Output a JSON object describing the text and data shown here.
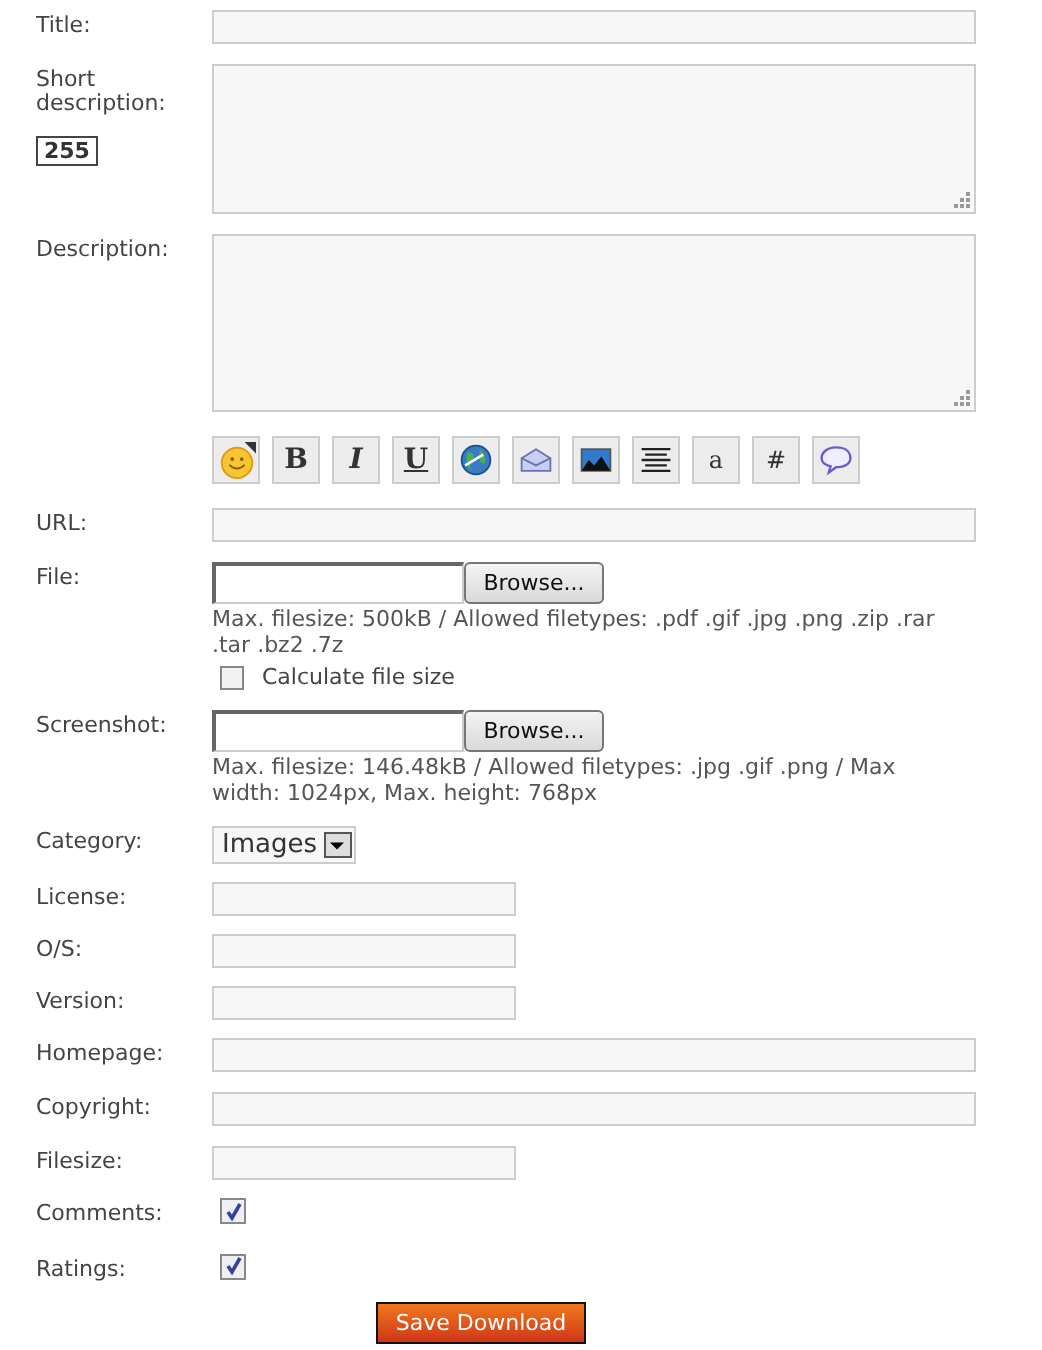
{
  "fields": [
    {
      "kind": "long-text",
      "label": "Title:"
    },
    {
      "kind": "textarea",
      "label": "Short description:",
      "counter": "255"
    },
    {
      "kind": "editor",
      "label": "Description:",
      "toolbar": [
        {
          "kind": "smiley"
        },
        {
          "kind": "bold",
          "glyph": "B"
        },
        {
          "kind": "italic",
          "glyph": "I"
        },
        {
          "kind": "underline",
          "glyph": "U"
        },
        {
          "kind": "globe"
        },
        {
          "kind": "envelope"
        },
        {
          "kind": "image"
        },
        {
          "kind": "align"
        },
        {
          "kind": "plain",
          "glyph": "a"
        },
        {
          "kind": "plain",
          "glyph": "#"
        },
        {
          "kind": "speech"
        }
      ]
    },
    {
      "kind": "long-text",
      "label": "URL:"
    },
    {
      "kind": "file",
      "label": "File:",
      "button": "Browse...",
      "note": "Max. filesize: 500kB / Allowed filetypes: .pdf .gif .jpg .png .zip .rar .tar .bz2 .7z",
      "option": {
        "label": "Calculate file size",
        "checked": false
      }
    },
    {
      "kind": "file",
      "label": "Screenshot:",
      "button": "Browse...",
      "note": "Max. filesize: 146.48kB / Allowed filetypes: .jpg .gif .png / Max width: 1024px, Max. height: 768px"
    },
    {
      "kind": "select",
      "label": "Category:",
      "value": "Images"
    },
    {
      "kind": "short-text",
      "label": "License:"
    },
    {
      "kind": "short-text",
      "label": "O/S:"
    },
    {
      "kind": "short-text",
      "label": "Version:"
    },
    {
      "kind": "long-text",
      "label": "Homepage:"
    },
    {
      "kind": "long-text",
      "label": "Copyright:"
    },
    {
      "kind": "short-text",
      "label": "Filesize:"
    },
    {
      "kind": "checkbox",
      "label": "Comments:",
      "checked": true
    },
    {
      "kind": "checkbox",
      "label": "Ratings:",
      "checked": true
    }
  ],
  "submit": "Save Download"
}
